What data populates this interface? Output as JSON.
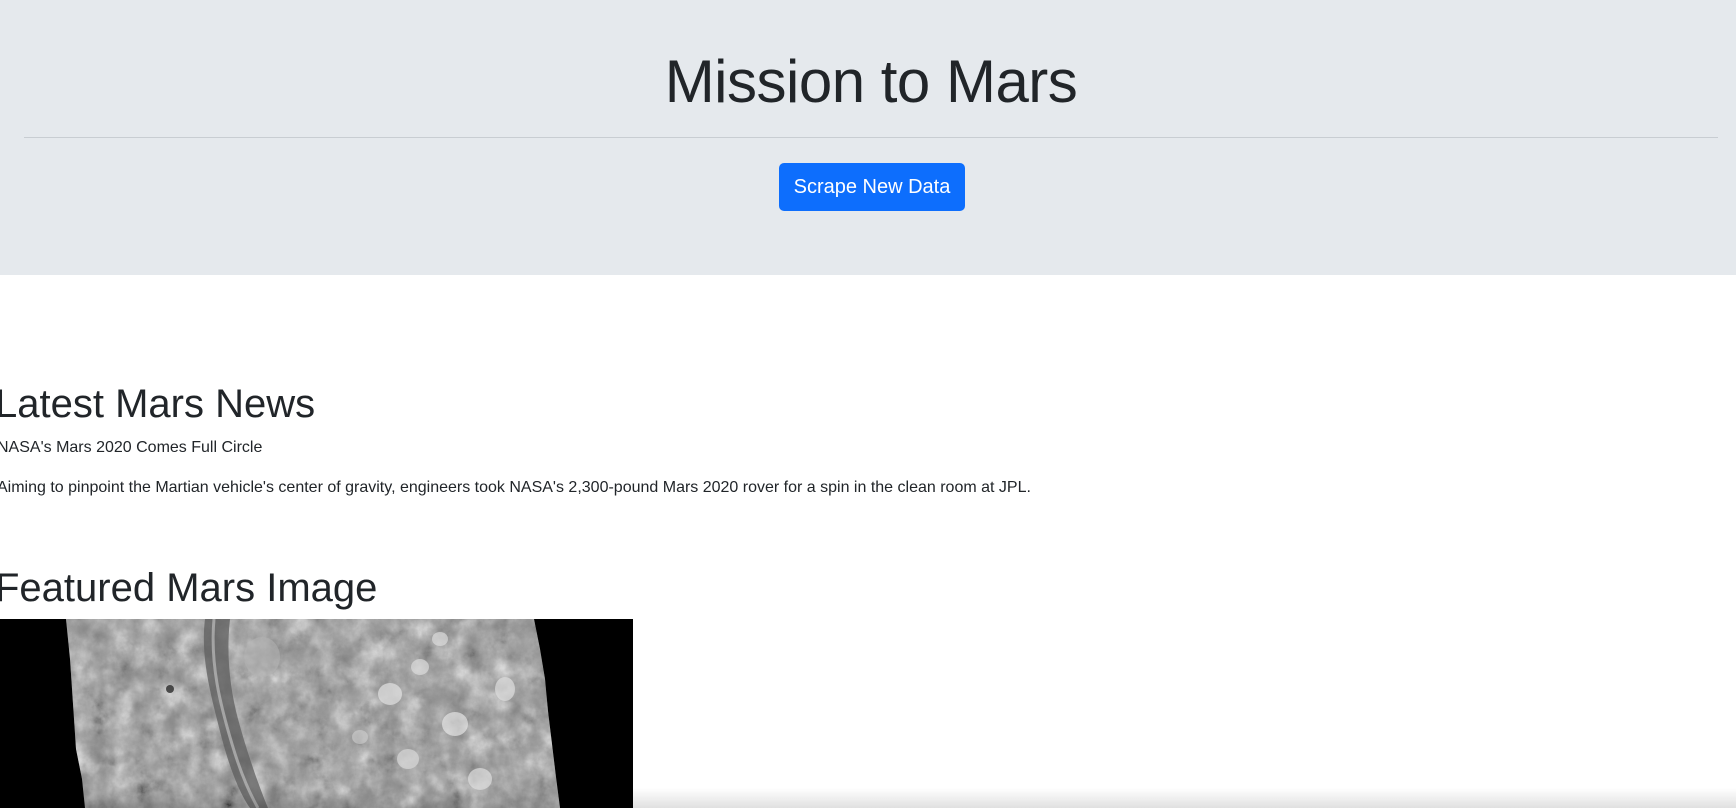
{
  "header": {
    "title": "Mission to Mars",
    "scrape_button_label": "Scrape New Data"
  },
  "news": {
    "heading": "Latest Mars News",
    "title": "NASA's Mars 2020 Comes Full Circle",
    "teaser": "Aiming to pinpoint the Martian vehicle's center of gravity, engineers took NASA's 2,300-pound Mars 2020 rover for a spin in the clean room at JPL."
  },
  "featured_image": {
    "heading": "Featured Mars Image"
  },
  "colors": {
    "jumbotron_bg": "#e5e9ed",
    "primary_button": "#0d6efd",
    "text": "#212529"
  }
}
